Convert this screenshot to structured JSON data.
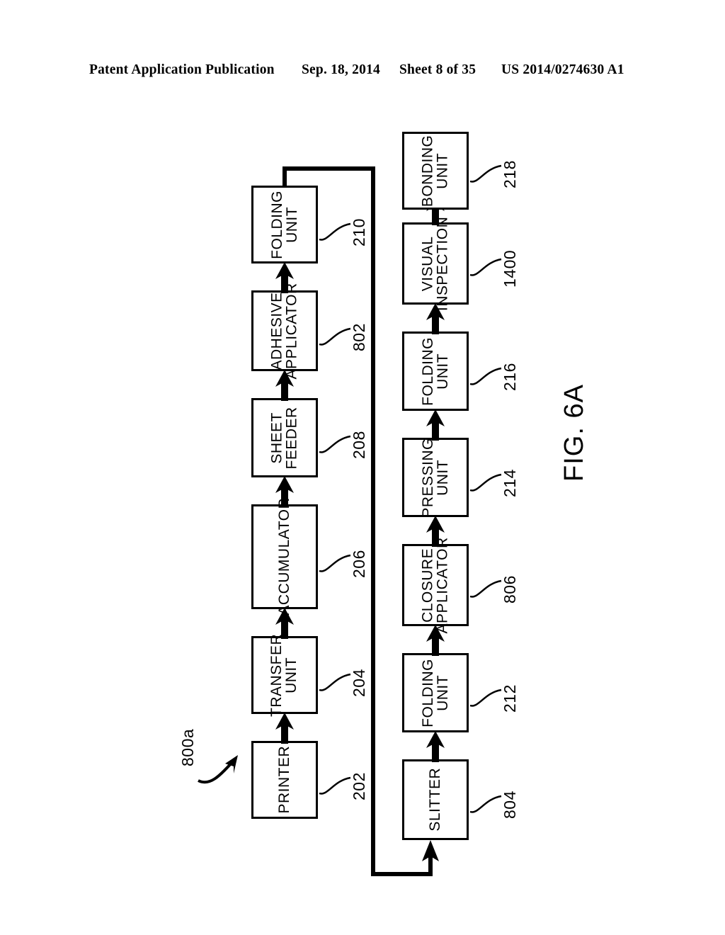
{
  "header": {
    "publication": "Patent Application Publication",
    "date": "Sep. 18, 2014",
    "sheet": "Sheet 8 of 35",
    "patent_number": "US 2014/0274630 A1"
  },
  "figure": {
    "caption": "FIG. 6A",
    "system_callout": "800a"
  },
  "diagram": {
    "type": "flow-block-diagram",
    "orientation": "rotated-90-ccw",
    "rows": [
      {
        "name": "upper-row",
        "flow": "left-to-right",
        "blocks": [
          {
            "id": "printer",
            "label_line1": "PRINTER",
            "label_line2": "",
            "ref": "202"
          },
          {
            "id": "transfer-unit",
            "label_line1": "TRANSFER",
            "label_line2": "UNIT",
            "ref": "204"
          },
          {
            "id": "accumulator",
            "label_line1": "ACCUMULATOR",
            "label_line2": "",
            "ref": "206"
          },
          {
            "id": "sheet-feeder",
            "label_line1": "SHEET",
            "label_line2": "FEEDER",
            "ref": "208"
          },
          {
            "id": "adhesive-applicator",
            "label_line1": "ADHESIVE",
            "label_line2": "APPLICATOR",
            "ref": "802"
          },
          {
            "id": "folding-unit-210",
            "label_line1": "FOLDING",
            "label_line2": "UNIT",
            "ref": "210"
          }
        ]
      },
      {
        "name": "lower-row",
        "flow": "left-to-right",
        "blocks": [
          {
            "id": "slitter",
            "label_line1": "SLITTER",
            "label_line2": "",
            "ref": "804"
          },
          {
            "id": "folding-unit-212",
            "label_line1": "FOLDING",
            "label_line2": "UNIT",
            "ref": "212"
          },
          {
            "id": "closure-applicator",
            "label_line1": "CLOSURE",
            "label_line2": "APPLICATOR",
            "ref": "806"
          },
          {
            "id": "pressing-unit",
            "label_line1": "PRESSING",
            "label_line2": "UNIT",
            "ref": "214"
          },
          {
            "id": "folding-unit-216",
            "label_line1": "FOLDING",
            "label_line2": "UNIT",
            "ref": "216"
          },
          {
            "id": "visual-inspection",
            "label_line1": "VISUAL",
            "label_line2": "INSPECTION",
            "ref": "1400"
          },
          {
            "id": "bonding-unit",
            "label_line1": "BONDING",
            "label_line2": "UNIT",
            "ref": "218"
          }
        ]
      }
    ],
    "connector": {
      "from": "folding-unit-210",
      "to": "slitter",
      "style": "thick-orthogonal-with-arrowhead"
    }
  }
}
